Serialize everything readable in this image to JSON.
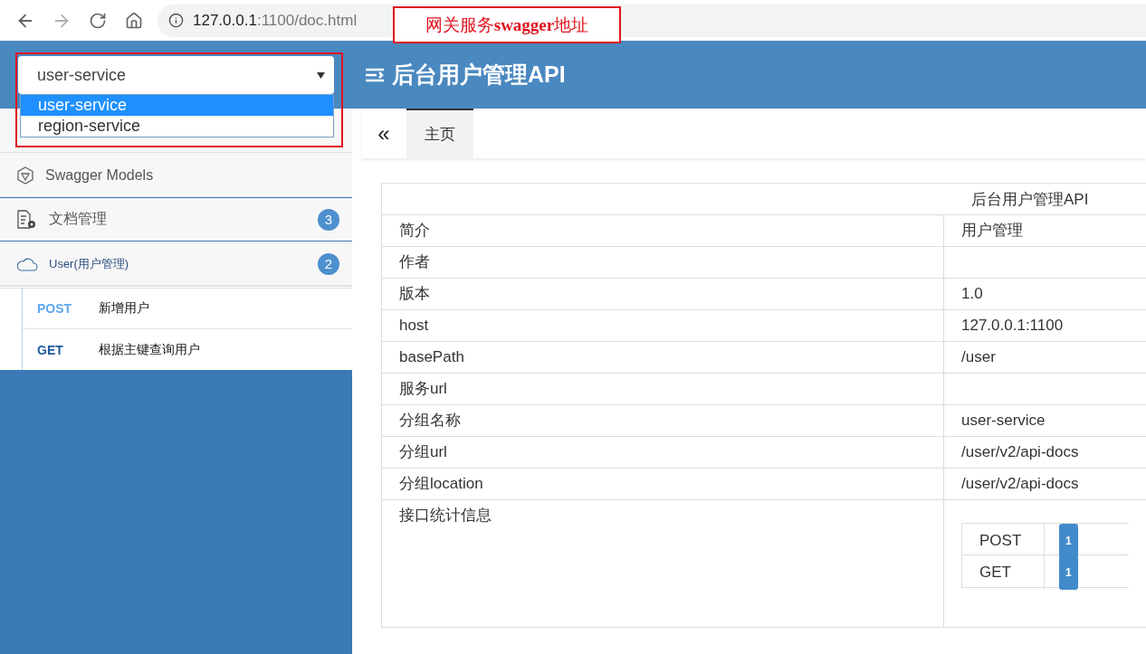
{
  "browser": {
    "url_host": "127.0.0.1",
    "url_rest": ":1100/doc.html"
  },
  "annotation": {
    "text": "网关服务**swagger**地址"
  },
  "service_select": {
    "value": "user-service",
    "options": [
      {
        "label": "user-service",
        "selected": true
      },
      {
        "label": "region-service",
        "selected": false
      }
    ]
  },
  "header": {
    "title": "后台用户管理API"
  },
  "sidebar": {
    "items": [
      {
        "kind": "models",
        "label": "Swagger Models",
        "selected": false
      },
      {
        "kind": "docs",
        "label": "文档管理",
        "count": "3",
        "selected": true
      },
      {
        "kind": "group",
        "label": "User(用户管理)",
        "count": "2",
        "selected": false
      }
    ],
    "apis": [
      {
        "method": "POST",
        "label": "新增用户",
        "color": "#5fa8ef"
      },
      {
        "method": "GET",
        "label": "根据主键查询用户",
        "color": "#1f5a9a"
      }
    ]
  },
  "tabs": {
    "collapse": "«",
    "items": [
      {
        "label": "主页",
        "selected": true
      }
    ]
  },
  "table": {
    "title": "后台用户管理API",
    "rows": [
      {
        "label": "简介",
        "value": "用户管理"
      },
      {
        "label": "作者"
      },
      {
        "label": "版本",
        "value": "1.0"
      },
      {
        "label": "host",
        "value": "127.0.0.1:1100"
      },
      {
        "label": "basePath",
        "value": "/user"
      },
      {
        "label": "服务url"
      },
      {
        "label": "分组名称",
        "value": "user-service"
      },
      {
        "label": "分组url",
        "value": "/user/v2/api-docs"
      },
      {
        "label": "分组location",
        "value": "/user/v2/api-docs"
      }
    ],
    "stats": {
      "label": "接口统计信息",
      "methods": [
        {
          "method": "POST",
          "count": "1"
        },
        {
          "method": "GET",
          "count": "1"
        }
      ]
    }
  }
}
